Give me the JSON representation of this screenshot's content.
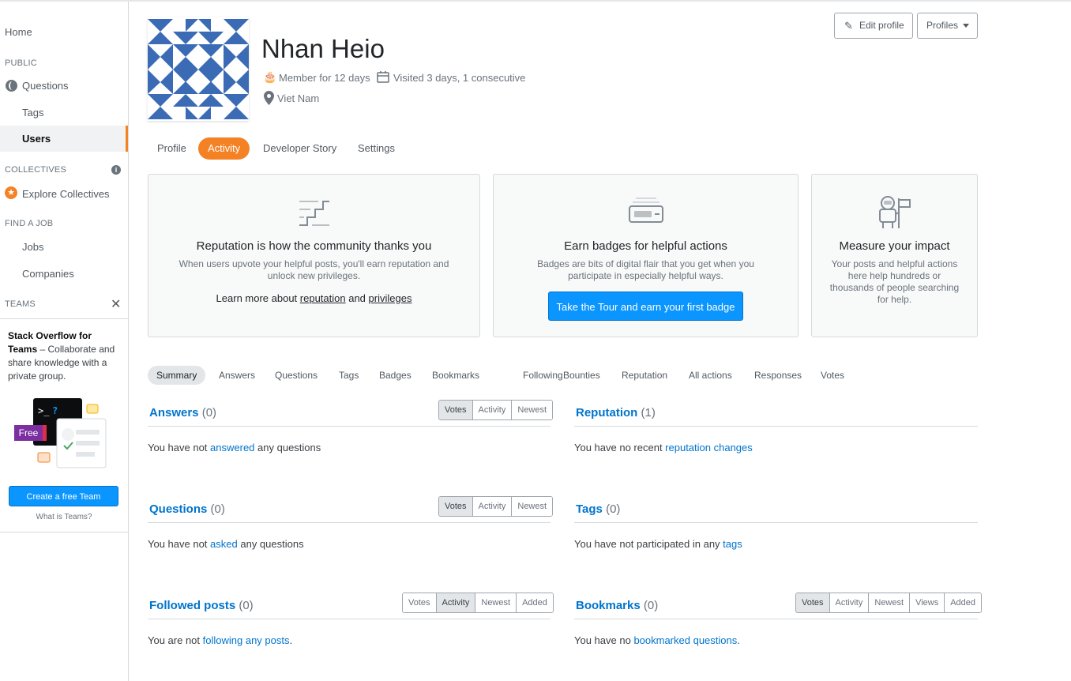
{
  "sidebar": {
    "home": "Home",
    "public_head": "PUBLIC",
    "questions": "Questions",
    "tags": "Tags",
    "users": "Users",
    "collectives_head": "COLLECTIVES",
    "explore_collectives": "Explore Collectives",
    "find_job_head": "FIND A JOB",
    "jobs": "Jobs",
    "companies": "Companies",
    "teams_head": "TEAMS",
    "teams_title": "Stack Overflow for Teams",
    "teams_desc": " – Collaborate and share knowledge with a private group.",
    "free_badge": "Free",
    "create_team": "Create a free Team",
    "what_is_teams": "What is Teams?"
  },
  "profile": {
    "name": "Nhan Heio",
    "member_for": "Member for 12 days",
    "visited": "Visited 3 days, 1 consecutive",
    "location": "Viet Nam",
    "edit_profile": "Edit profile",
    "profiles": "Profiles"
  },
  "tabs": [
    "Profile",
    "Activity",
    "Developer Story",
    "Settings"
  ],
  "cards": {
    "reputation": {
      "title": "Reputation is how the community thanks you",
      "desc": "When users upvote your helpful posts, you'll earn reputation and unlock new privileges.",
      "link_prefix": "Learn more about ",
      "link_reputation": "reputation",
      "link_and": " and ",
      "link_privileges": "privileges"
    },
    "badges": {
      "title": "Earn badges for helpful actions",
      "desc": "Badges are bits of digital flair that you get when you participate in especially helpful ways.",
      "button": "Take the Tour and earn your first badge"
    },
    "impact": {
      "title": "Measure your impact",
      "desc": "Your posts and helpful actions here help hundreds or thousands of people searching for help."
    }
  },
  "subtabs": [
    "Summary",
    "Answers",
    "Questions",
    "Tags",
    "Badges",
    "Bookmarks",
    "Following",
    "Bounties",
    "Reputation",
    "All actions",
    "Responses",
    "Votes"
  ],
  "sections": {
    "answers": {
      "title": "Answers",
      "count": "(0)",
      "filters": [
        "Votes",
        "Activity",
        "Newest"
      ],
      "active": "Votes",
      "text": "You have not ",
      "link": "answered",
      "text2": " any questions"
    },
    "reputation": {
      "title": "Reputation",
      "count": "(1)",
      "text": "You have no recent ",
      "link": "reputation changes",
      "text2": ""
    },
    "questions": {
      "title": "Questions",
      "count": "(0)",
      "filters": [
        "Votes",
        "Activity",
        "Newest"
      ],
      "active": "Votes",
      "text": "You have not ",
      "link": "asked",
      "text2": " any questions"
    },
    "tags": {
      "title": "Tags",
      "count": "(0)",
      "text": "You have not participated in any ",
      "link": "tags",
      "text2": ""
    },
    "followed": {
      "title": "Followed posts",
      "count": "(0)",
      "filters": [
        "Votes",
        "Activity",
        "Newest",
        "Added"
      ],
      "active": "Activity",
      "text": "You are not ",
      "link": "following any posts",
      "text2": "."
    },
    "bookmarks": {
      "title": "Bookmarks",
      "count": "(0)",
      "filters": [
        "Votes",
        "Activity",
        "Newest",
        "Views",
        "Added"
      ],
      "active": "Votes",
      "text": "You have no ",
      "link": "bookmarked questions",
      "text2": "."
    }
  },
  "colors": {
    "accent": "#f48225",
    "link": "#0074cc",
    "button": "#0a95ff",
    "avatar": "#3b6bb5"
  }
}
